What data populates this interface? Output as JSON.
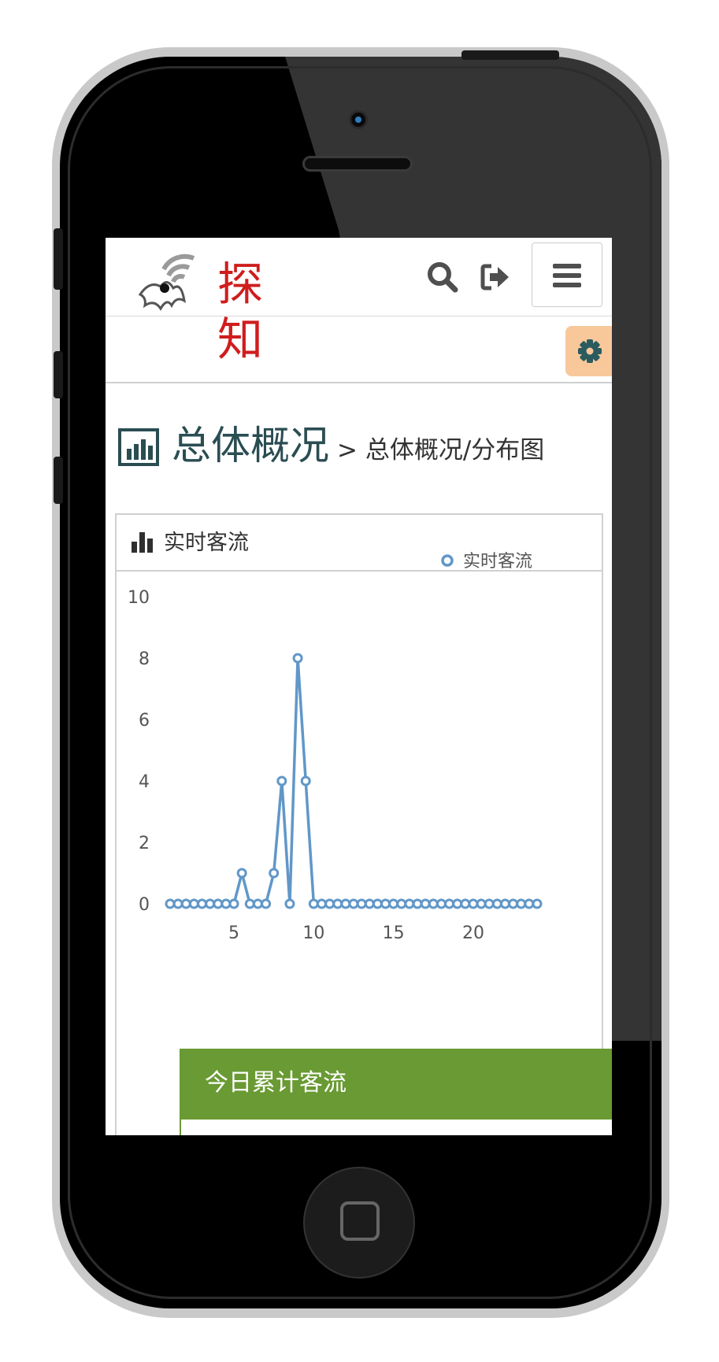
{
  "app": {
    "logo_text": "探知"
  },
  "header": {
    "title": "总体概况",
    "breadcrumb": "> 总体概况/分布图"
  },
  "icons": {
    "search": "search-icon",
    "logout": "logout-icon",
    "menu": "hamburger-menu-icon",
    "settings": "gear-icon",
    "page_title": "bar-chart-icon",
    "panel_title": "bar-chart-icon"
  },
  "colors": {
    "logo_red": "#cf1d1d",
    "title_teal": "#2a4d52",
    "series_line": "#6197c8",
    "settings_bg": "#f8c89b",
    "card_green": "#6a9a33"
  },
  "panel": {
    "title": "实时客流"
  },
  "chart_data": {
    "type": "line",
    "title": "",
    "xlabel": "",
    "ylabel": "",
    "x_ticks": [
      5,
      10,
      15,
      20
    ],
    "y_ticks": [
      0,
      2,
      4,
      6,
      8,
      10
    ],
    "xlim": [
      1,
      24
    ],
    "ylim": [
      0,
      10
    ],
    "grid": false,
    "legend_position": "top-right",
    "series": [
      {
        "name": "实时客流",
        "color": "#6197c8",
        "x": [
          1,
          1.5,
          2,
          2.5,
          3,
          3.5,
          4,
          4.5,
          5,
          5.5,
          6,
          6.5,
          7,
          7.5,
          8,
          8.5,
          9,
          9.5,
          10,
          10.5,
          11,
          11.5,
          12,
          12.5,
          13,
          13.5,
          14,
          14.5,
          15,
          15.5,
          16,
          16.5,
          17,
          17.5,
          18,
          18.5,
          19,
          19.5,
          20,
          20.5,
          21,
          21.5,
          22,
          22.5,
          23,
          23.5,
          24
        ],
        "y": [
          0,
          0,
          0,
          0,
          0,
          0,
          0,
          0,
          0,
          1,
          0,
          0,
          0,
          1,
          4,
          0,
          8,
          4,
          0,
          0,
          0,
          0,
          0,
          0,
          0,
          0,
          0,
          0,
          0,
          0,
          0,
          0,
          0,
          0,
          0,
          0,
          0,
          0,
          0,
          0,
          0,
          0,
          0,
          0,
          0,
          0,
          0
        ]
      }
    ]
  },
  "summary_card": {
    "title": "今日累计客流"
  }
}
